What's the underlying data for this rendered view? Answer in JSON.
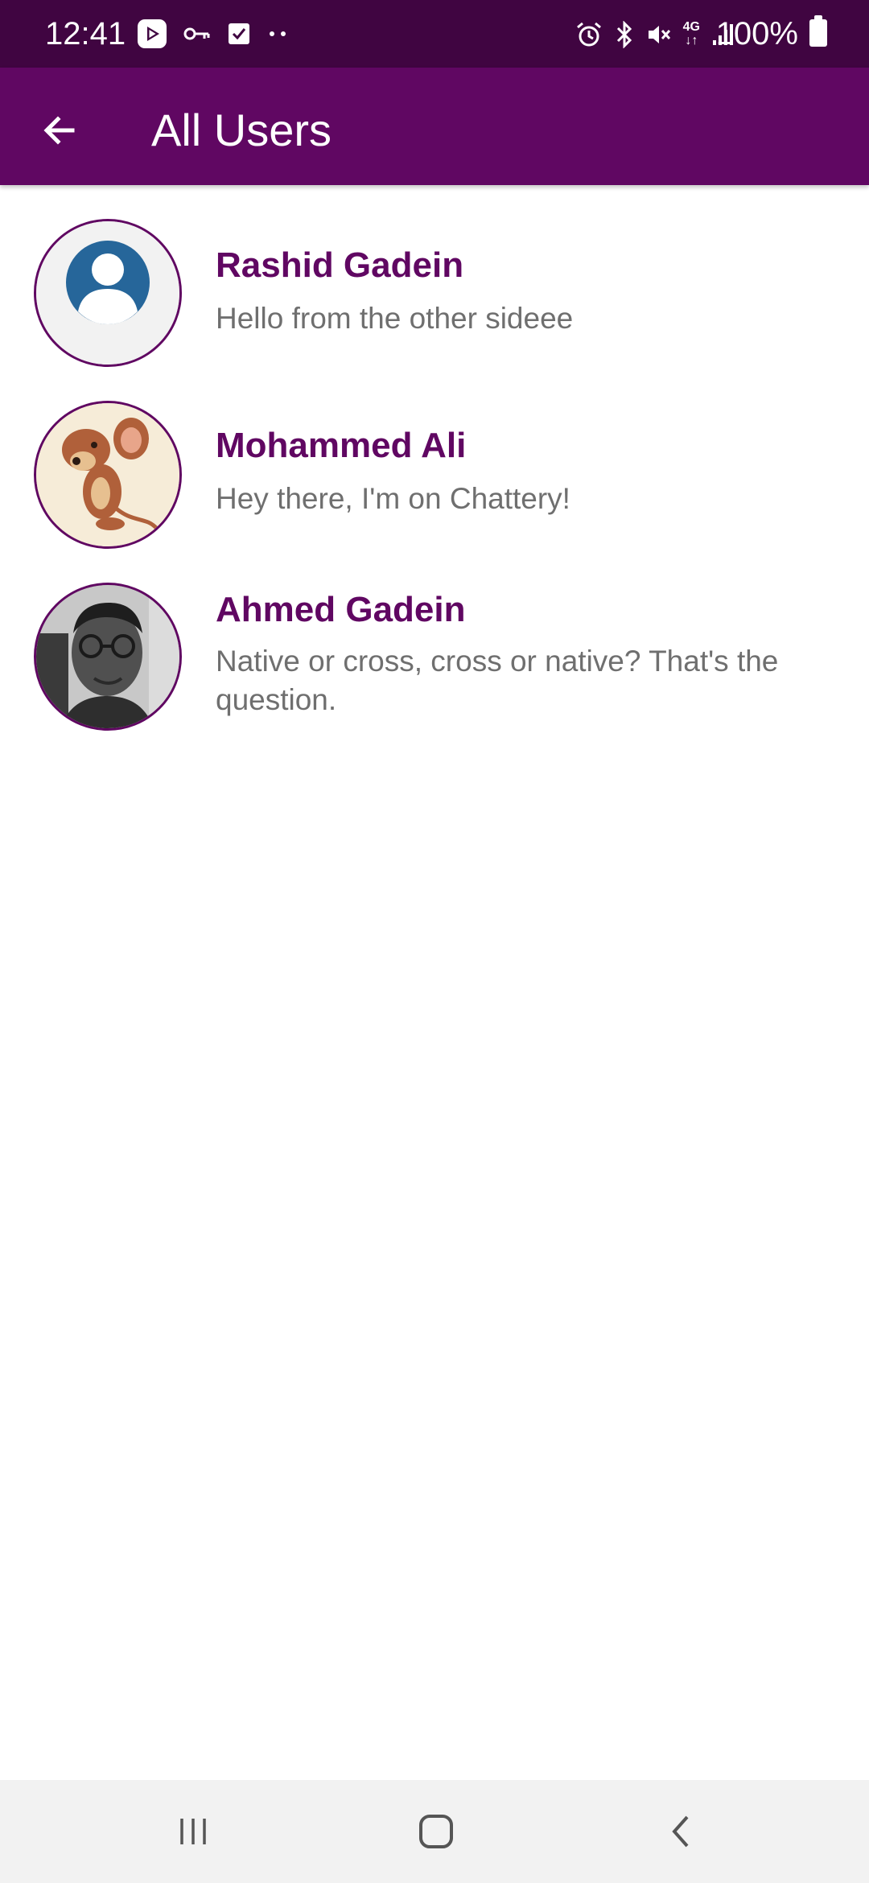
{
  "status_bar": {
    "time": "12:41",
    "battery": "100%",
    "icons": [
      "play-store-icon",
      "vpn-key-icon",
      "checkbox-icon",
      "more-notifications-icon",
      "alarm-icon",
      "bluetooth-icon",
      "mute-icon",
      "4g-icon",
      "signal-icon",
      "battery-icon"
    ],
    "network_label": "4G"
  },
  "app_bar": {
    "title": "All Users",
    "back_icon": "arrow-back-icon"
  },
  "users": [
    {
      "name": "Rashid Gadein",
      "status": "Hello from the other sideee",
      "avatar": "default-avatar"
    },
    {
      "name": "Mohammed Ali",
      "status": "Hey there, I'm on Chattery!",
      "avatar": "cartoon-mouse-avatar"
    },
    {
      "name": "Ahmed Gadein",
      "status": "Native or cross, cross or native? That's the question.",
      "avatar": "photo-avatar"
    }
  ],
  "nav_bar": {
    "buttons": [
      "recent-apps-icon",
      "home-icon",
      "back-icon"
    ]
  },
  "colors": {
    "status_bar": "#400541",
    "app_bar": "#600762",
    "accent_text": "#600762",
    "secondary_text": "#6f6f6f",
    "nav_bar": "#f2f2f2"
  }
}
